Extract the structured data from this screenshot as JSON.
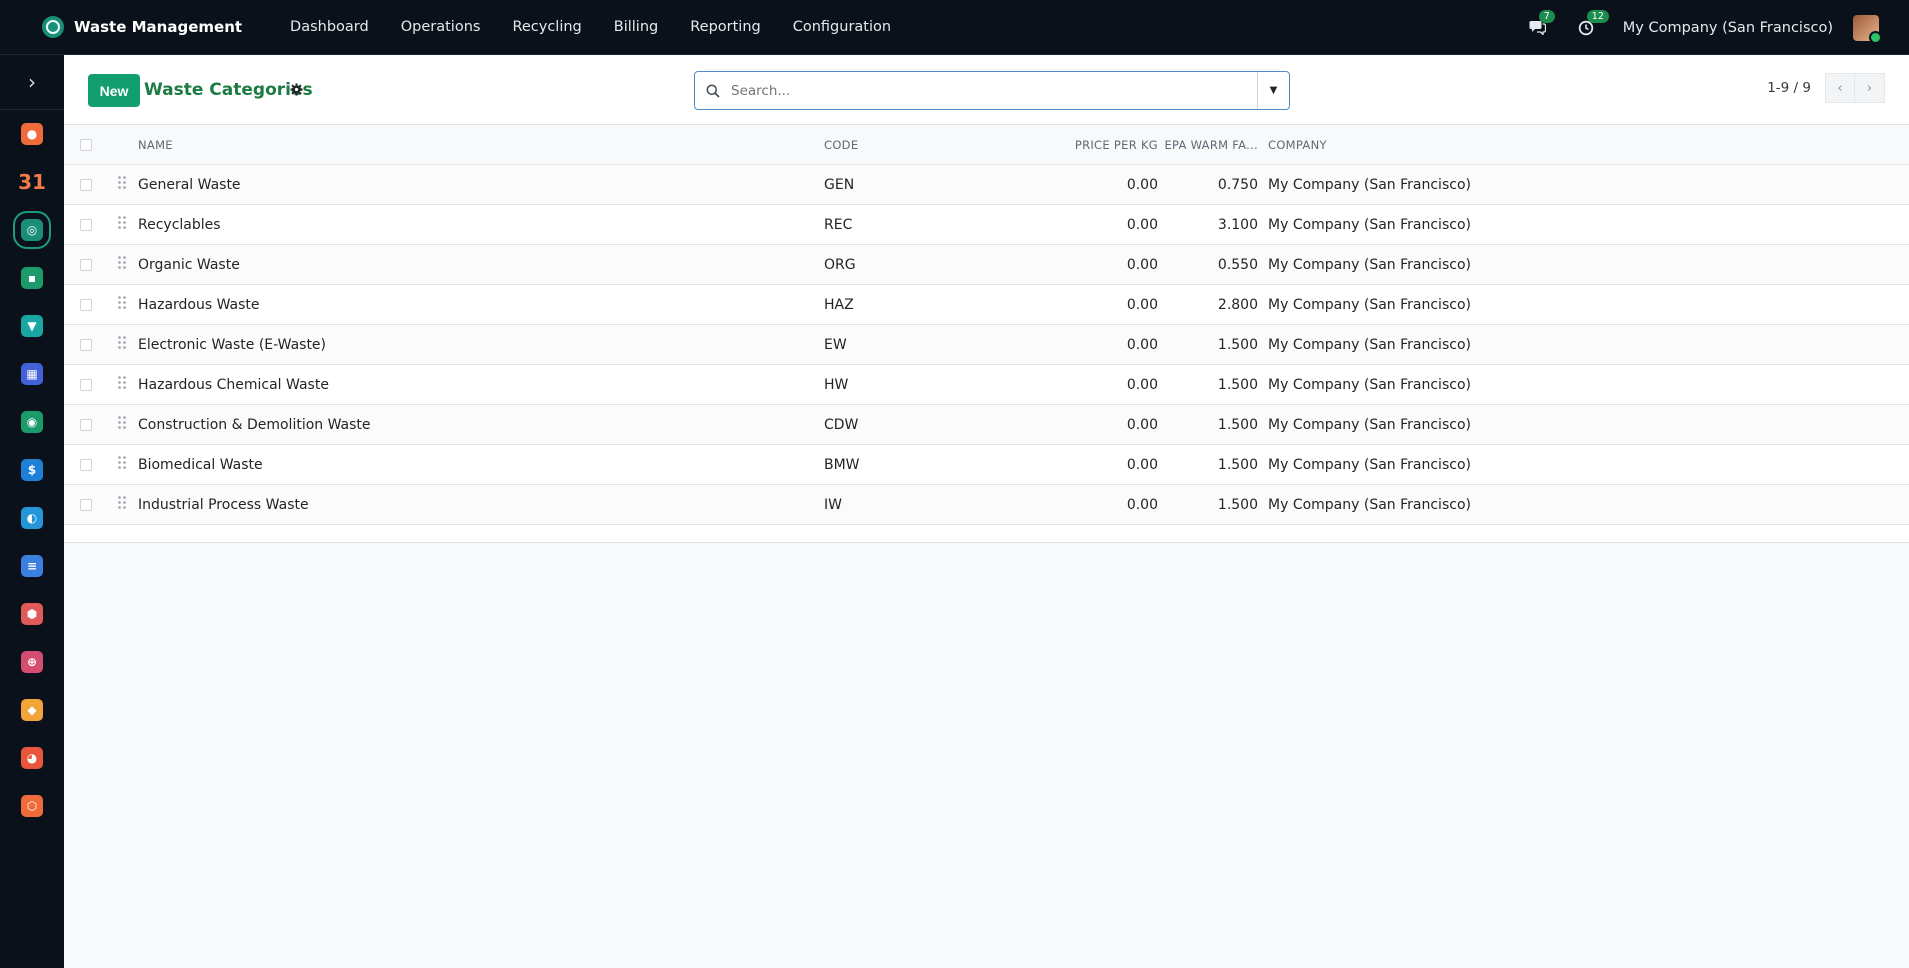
{
  "app": {
    "name": "Waste Management",
    "menu": [
      "Dashboard",
      "Operations",
      "Recycling",
      "Billing",
      "Reporting",
      "Configuration"
    ],
    "messages_count": "7",
    "activities_count": "12",
    "company": "My Company (San Francisco)"
  },
  "sidebar": {
    "apps": [
      {
        "icon": "discuss-icon",
        "color": "#f06b3a",
        "glyph": "●"
      },
      {
        "icon": "calendar-icon",
        "color": "#0b111a",
        "glyph": "31"
      },
      {
        "icon": "waste-management-icon",
        "color": "#1a8e79",
        "glyph": "◎"
      },
      {
        "icon": "contacts-icon",
        "color": "#1b9a6b",
        "glyph": "▪"
      },
      {
        "icon": "crm-icon",
        "color": "#1aa5a5",
        "glyph": "▼"
      },
      {
        "icon": "dashboards-icon",
        "color": "#4361d8",
        "glyph": "▦"
      },
      {
        "icon": "sign-icon",
        "color": "#1b9a6b",
        "glyph": "◉"
      },
      {
        "icon": "invoicing-icon",
        "color": "#1e7fd6",
        "glyph": "$"
      },
      {
        "icon": "website-icon",
        "color": "#2496d8",
        "glyph": "◐"
      },
      {
        "icon": "project-icon",
        "color": "#3b7fe0",
        "glyph": "≡"
      },
      {
        "icon": "inventory-icon",
        "color": "#e05a5a",
        "glyph": "⬢"
      },
      {
        "icon": "fleet-icon",
        "color": "#d64d72",
        "glyph": "⊕"
      },
      {
        "icon": "expenses-icon",
        "color": "#f0a43a",
        "glyph": "◆"
      },
      {
        "icon": "surveys-icon",
        "color": "#e8553a",
        "glyph": "◕"
      },
      {
        "icon": "apps-icon",
        "color": "#f06b3a",
        "glyph": "⬡"
      }
    ]
  },
  "control_panel": {
    "new_label": "New",
    "title": "Waste Categories",
    "search_placeholder": "Search...",
    "pager_value": "1-9 / 9"
  },
  "table": {
    "headers": {
      "name": "NAME",
      "code": "CODE",
      "price": "PRICE PER KG",
      "epa": "EPA WARM FA...",
      "company": "COMPANY"
    },
    "rows": [
      {
        "name": "General Waste",
        "code": "GEN",
        "price": "0.00",
        "epa": "0.750",
        "company": "My Company (San Francisco)"
      },
      {
        "name": "Recyclables",
        "code": "REC",
        "price": "0.00",
        "epa": "3.100",
        "company": "My Company (San Francisco)"
      },
      {
        "name": "Organic Waste",
        "code": "ORG",
        "price": "0.00",
        "epa": "0.550",
        "company": "My Company (San Francisco)"
      },
      {
        "name": "Hazardous Waste",
        "code": "HAZ",
        "price": "0.00",
        "epa": "2.800",
        "company": "My Company (San Francisco)"
      },
      {
        "name": "Electronic Waste (E-Waste)",
        "code": "EW",
        "price": "0.00",
        "epa": "1.500",
        "company": "My Company (San Francisco)"
      },
      {
        "name": "Hazardous Chemical Waste",
        "code": "HW",
        "price": "0.00",
        "epa": "1.500",
        "company": "My Company (San Francisco)"
      },
      {
        "name": "Construction & Demolition Waste",
        "code": "CDW",
        "price": "0.00",
        "epa": "1.500",
        "company": "My Company (San Francisco)"
      },
      {
        "name": "Biomedical Waste",
        "code": "BMW",
        "price": "0.00",
        "epa": "1.500",
        "company": "My Company (San Francisco)"
      },
      {
        "name": "Industrial Process Waste",
        "code": "IW",
        "price": "0.00",
        "epa": "1.500",
        "company": "My Company (San Francisco)"
      }
    ]
  }
}
